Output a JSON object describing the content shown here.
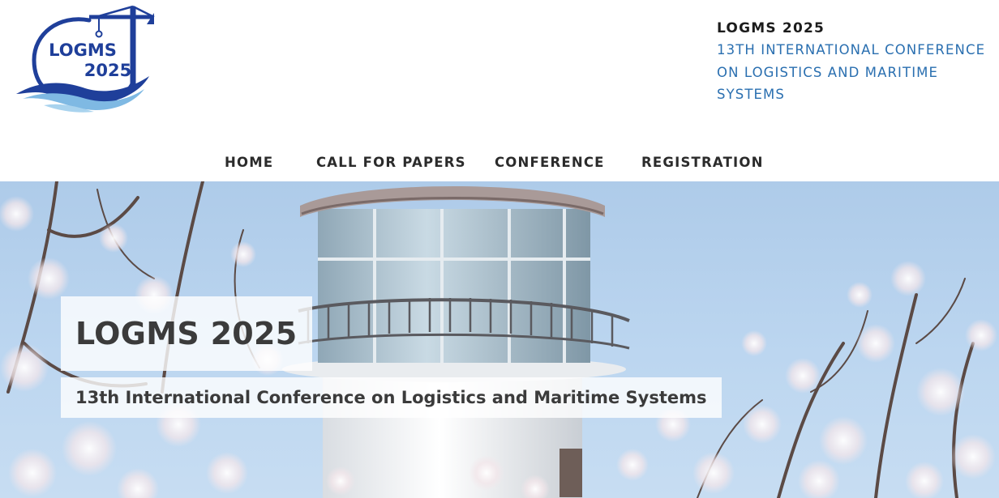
{
  "logo": {
    "line1": "LOGMS",
    "line2": "2025"
  },
  "header": {
    "title": "LOGMS 2025",
    "subtitle": "13TH INTERNATIONAL CONFERENCE ON LOGISTICS AND MARITIME SYSTEMS"
  },
  "nav": {
    "items": [
      {
        "label": "HOME"
      },
      {
        "label": "CALL FOR PAPERS"
      },
      {
        "label": "CONFERENCE"
      },
      {
        "label": "REGISTRATION"
      }
    ]
  },
  "hero": {
    "title": "LOGMS 2025",
    "subtitle": "13th International Conference on Logistics and Maritime Systems"
  },
  "colors": {
    "accent_blue": "#2a6fb0",
    "logo_navy": "#1f3f9a",
    "logo_wave_light": "#7fb9e3",
    "nav_text": "#2b2b2b"
  }
}
